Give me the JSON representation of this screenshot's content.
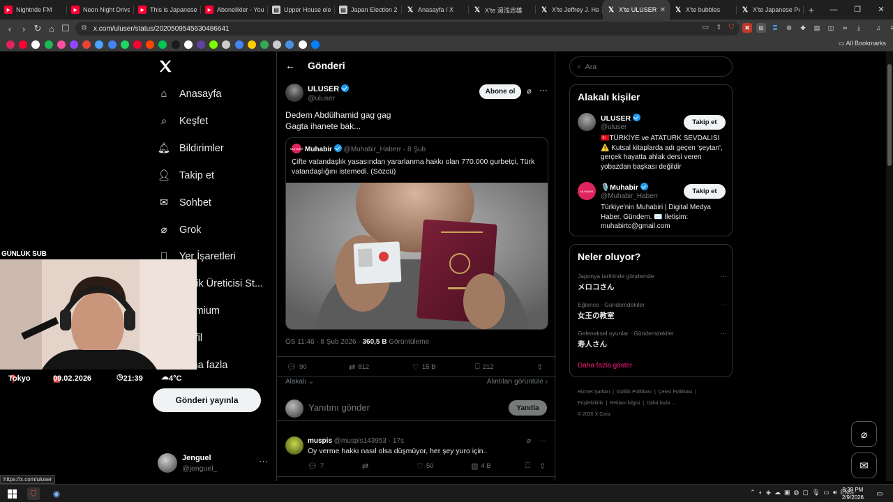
{
  "browser": {
    "tabs": [
      {
        "title": "Nightride FM",
        "fav": "youtube-icon",
        "color": "#ff0033"
      },
      {
        "title": "Neon Night Drive",
        "fav": "youtube-icon",
        "color": "#ff0033"
      },
      {
        "title": "This is Japanese",
        "fav": "youtube-icon",
        "color": "#ff0033"
      },
      {
        "title": "Abonelikler - You",
        "fav": "youtube-icon",
        "color": "#ff0033"
      },
      {
        "title": "Upper House ele",
        "fav": "news-icon",
        "color": "#d0d0d0"
      },
      {
        "title": "Japan Election 20",
        "fav": "news-icon",
        "color": "#d0d0d0"
      },
      {
        "title": "Anasayfa / X",
        "fav": "x-icon",
        "color": "#ffffff"
      },
      {
        "title": "X'te 湯浅忠雄",
        "fav": "x-icon",
        "color": "#ffffff"
      },
      {
        "title": "X'te Jeffrey J. Hal",
        "fav": "x-icon",
        "color": "#ffffff"
      },
      {
        "title": "X'te ULUSER",
        "fav": "x-icon",
        "color": "#ffffff",
        "active": true
      },
      {
        "title": "X'te bubbles",
        "fav": "x-icon",
        "color": "#ffffff"
      },
      {
        "title": "X'te Japanese Po",
        "fav": "x-icon",
        "color": "#ffffff"
      }
    ],
    "url": "x.com/uluser/status/2020509545630486641",
    "all_bookmarks": "All Bookmarks",
    "hover_url": "https://x.com/uluser"
  },
  "nav": {
    "items": [
      {
        "label": "Anasayfa",
        "icon": "home-icon"
      },
      {
        "label": "Keşfet",
        "icon": "search-icon"
      },
      {
        "label": "Bildirimler",
        "icon": "bell-icon"
      },
      {
        "label": "Takip et",
        "icon": "person-plus-icon"
      },
      {
        "label": "Sohbet",
        "icon": "mail-icon"
      },
      {
        "label": "Grok",
        "icon": "grok-icon"
      },
      {
        "label": "Yer İşaretleri",
        "icon": "bookmark-icon"
      },
      {
        "label": "İçerik Üreticisi St...",
        "icon": "studio-icon"
      },
      {
        "label": "Premium",
        "icon": "premium-icon"
      },
      {
        "label": "Profil",
        "icon": "profile-icon"
      },
      {
        "label": "Daha fazla",
        "icon": "more-icon"
      }
    ],
    "post_button": "Gönderi yayınla",
    "profile": {
      "name": "Jenguel",
      "handle": "@jenguel_"
    }
  },
  "post": {
    "header": "Gönderi",
    "author": {
      "name": "ULUSER",
      "handle": "@uluser"
    },
    "follow_label": "Abone ol",
    "text_lines": [
      "Dedem Abdülhamid gag gag",
      "Gagta ihanete bak..."
    ],
    "quote": {
      "name": "Muhabir",
      "handle": "@Muhabir_Haberr",
      "time": "8 Şub",
      "avatar_text": "MUHABIR",
      "text": "Çifte vatandaşlık yasasından yararlanma hakkı olan 770.000 gurbetçi, Türk vatandaşlığını istemedi. (Sözcü)"
    },
    "meta": {
      "time": "ÖS 11:46 · 8 Şub 2026 · ",
      "views": "360,5 B",
      "views_label": " Görüntüleme"
    },
    "actions": {
      "replies": "90",
      "reposts": "812",
      "likes": "15 B",
      "bookmarks": "212"
    },
    "links": {
      "related": "Alakalı",
      "quotes": "Alıntıları görüntüle"
    },
    "reply": {
      "placeholder": "Yanıtını gönder",
      "button": "Yanıtla"
    },
    "comment": {
      "name": "muspis",
      "handle": "@muspis143953",
      "time": "17s",
      "text": "Oy verme hakkı nasıl olsa düşmüyor, her şey yuro için..",
      "replies": "7",
      "likes": "50",
      "views": "4 B"
    }
  },
  "sidebar": {
    "search_placeholder": "Ara",
    "people_title": "Alakalı kişiler",
    "people": [
      {
        "name": "ULUSER",
        "handle": "@uluser",
        "bio": "🇹🇷TÜRKİYE ve ATATURK SEVDALISI ⚠️ Kutsal kitaplarda adı geçen 'şeytan', gerçek hayatta ahlak dersi veren yobazdan başkası değildir",
        "button": "Takip et"
      },
      {
        "name": "🎙️Muhabir",
        "handle": "@Muhabir_Haberr",
        "bio": "Türkiye'nin Muhabiri | Digital Medya Haber. Gündem. ✉️ İletişim: muhabirtc@gmail.com",
        "button": "Takip et"
      }
    ],
    "trends_title": "Neler oluyor?",
    "trends": [
      {
        "context": "Japonya tarihinde gündemde",
        "topic": "メロコさん"
      },
      {
        "context": "Eğlence · Gündemdekiler",
        "topic": "女王の教室"
      },
      {
        "context": "Geleneksel oyunlar · Gündemdekiler",
        "topic": "寿人さん"
      }
    ],
    "show_more": "Daha fazla göster",
    "footer": [
      "Hizmet Şartları",
      "Gizlilik Politikası",
      "Çerez Politikası",
      "Erişilebilirlik",
      "Reklam bilgisi",
      "Daha fazla ...",
      "© 2026 X Corp."
    ]
  },
  "overlay": {
    "sub_label": "GÜNLÜK SUB",
    "location": "Tokyo",
    "date": "09.02.2026",
    "time": "21:39",
    "temp": "4°C"
  },
  "taskbar": {
    "lang": "ENG",
    "time": "9:39 PM",
    "date": "2/9/2026"
  }
}
